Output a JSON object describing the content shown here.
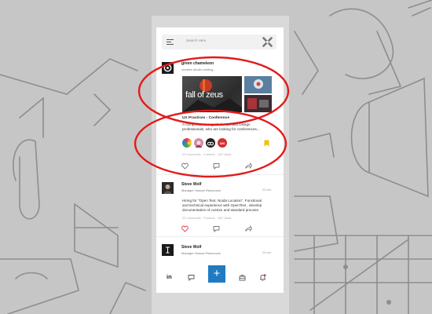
{
  "search": {
    "placeholder": "Search Here"
  },
  "posts": [
    {
      "author": "green chameleon",
      "subtitle": "creative studio crafting...",
      "image_headline": "fall of zeus",
      "title": "UX Practices - Conference",
      "text": [
        "A comprehensive guide for UX and Design",
        "professionals, who are looking for conferences..."
      ],
      "meta": "22 Comments · 3 shares · 128 Views",
      "participants": [
        "participant-1",
        "participant-2",
        "participant-3",
        "participant-4"
      ],
      "participant_badge": "300"
    },
    {
      "author": "Steve Wolf",
      "subtitle": "Manager Human Resources",
      "time": "20 min",
      "text": [
        "Hiring for \"Open Text, Noida Location\". Functional",
        "and technical experience with OpenText , develop",
        "documentation of custom and standard process."
      ],
      "meta": "22 Comments · 3 shares · 128 Views"
    },
    {
      "author": "Steve Wolf",
      "subtitle": "Manager Human Resources",
      "time": "20 min"
    }
  ],
  "bottom_nav": {
    "home_label": "in",
    "add_label": "+"
  },
  "colors": {
    "accent": "#1f7bc2",
    "highlight": "#e21b1b",
    "bookmark": "#f2c200",
    "like": "#e0414f"
  }
}
